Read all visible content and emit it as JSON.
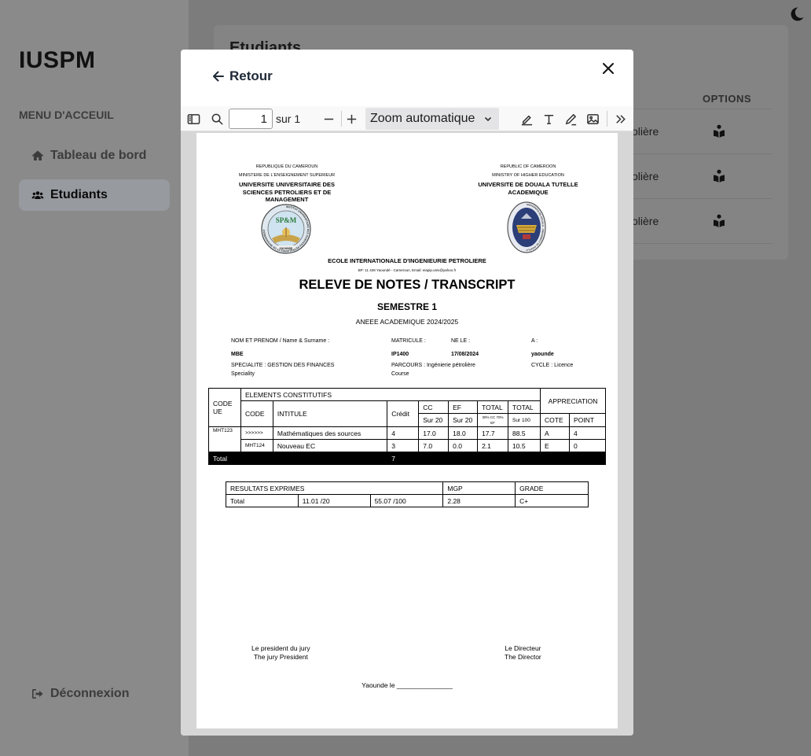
{
  "app": {
    "brand": "IUSPM",
    "menu_heading": "MENU D'ACCEUIL",
    "nav": {
      "dashboard": "Tableau de bord",
      "students": "Etudiants",
      "logout": "Déconnexion"
    }
  },
  "background_card": {
    "title": "Etudiants",
    "options_header": "OPTIONS",
    "rows": [
      {
        "parcours_partial": "olière"
      },
      {
        "parcours_partial": "olière"
      },
      {
        "parcours_partial": "olière"
      }
    ]
  },
  "modal": {
    "back_label": "Retour",
    "viewer": {
      "page_number": "1",
      "page_of": "sur 1",
      "zoom": "Zoom automatique"
    }
  },
  "transcript": {
    "left_header": {
      "line1": "REPUBLIQUE DU CAMEROUN",
      "line2": "MINISTERE DE L'ENSEIGNEMENT SUPERIEUR",
      "university": "UNIVERSITE UNIVERSITAIRE DES SCIENCES PETROLIERS ET DE MANAGEMENT"
    },
    "left_seal": {
      "acronym": "SP&M",
      "ring_text": "INSTITUT UNIVERSITAIRE DES SCIENCES PETROLIERES ET DE MANAGEMENT",
      "city": "YAOUNDE"
    },
    "right_header": {
      "line1": "REPUBLIC OF CAMEROON",
      "line2": "MINISTRY OF HIGHER EDUCATION",
      "university": "UNIVERSITE DE DOUALA TUTELLE ACADEMIQUE"
    },
    "right_seal": {
      "ring_text": "UNIVERSITE DE DOUALA - UNIVERSITY OF DOUALA"
    },
    "school": "ECOLE INTERNATIONALE D'INGENIEURIE PETROLIERE",
    "address": "BP: 11 428 Yaoundé - Cameroun, Email: eiapip.univ@yahoo.fr",
    "title": "RELEVE DE NOTES / TRANSCRIPT",
    "semester": "SEMESTRE 1",
    "year": "ANEEE ACADEMIQUE 2024/2025",
    "student": {
      "name_label": "NOM ET PRENOM / Name & Surname :",
      "name": "MBE",
      "matricule_label": "MATRICULE :",
      "matricule": "IP1400",
      "born_label": "NE LE :",
      "born": "17/08/2024",
      "at_label": "A :",
      "at": "yaounde",
      "speciality_label": "SPECIALITE : GESTION DES FINANCES",
      "speciality_sub": "Speciality",
      "parcours_label": "PARCOURS : Ingénierie pétrolière",
      "parcours_sub": "Course",
      "cycle": "CYCLE : Licence"
    },
    "marks_table": {
      "code_ue": "CODE UE",
      "elements": "ELEMENTS CONSTITUTIFS",
      "code": "CODE",
      "intitule": "INTITULE",
      "credit": "Crédit",
      "cc": "CC",
      "ef": "EF",
      "total": "TOTAL",
      "total2": "TOTAL",
      "appreciation": "APPRECIATION",
      "sur20_cc": "Sur 20",
      "sur20_ef": "Sur 20",
      "weights": "30% CC 70% EF",
      "sur100": "Sur 100",
      "cote": "COTE",
      "point": "POINT",
      "rows": [
        {
          "ue": "MHT123",
          "code": ">>>>>>",
          "intitule": "Mathématiques des sources",
          "credit": "4",
          "cc": "17.0",
          "ef": "18.0",
          "total": "17.7",
          "total100": "88.5",
          "cote": "A",
          "point": "4"
        },
        {
          "ue": "",
          "code": "MHT124",
          "intitule": "Nouveau EC",
          "credit": "3",
          "cc": "7.0",
          "ef": "0.0",
          "total": "2.1",
          "total100": "10.5",
          "cote": "E",
          "point": "0"
        }
      ],
      "total_label": "Total",
      "total_credit": "7"
    },
    "results_table": {
      "header": "RESULTATS EXPRIMES",
      "mgp_header": "MGP",
      "grade_header": "GRADE",
      "total_label": "Total",
      "score20": "11.01 /20",
      "score100": "55.07 /100",
      "mgp": "2.28",
      "grade": "C+"
    },
    "signatures": {
      "left1": "Le president du jury",
      "left2": "The jury President",
      "right1": "Le Directeur",
      "right2": "The Director"
    },
    "date_line": "Yaounde le _______________"
  }
}
